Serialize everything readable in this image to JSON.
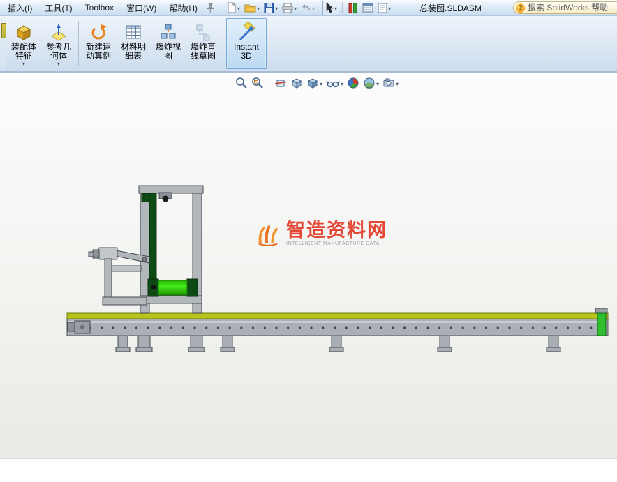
{
  "window": {
    "document_title": "总装图.SLDASM"
  },
  "menubar": {
    "items": [
      "插入(I)",
      "工具(T)",
      "Toolbox",
      "窗口(W)",
      "帮助(H)"
    ],
    "search_placeholder": "搜索 SolidWorks 帮助"
  },
  "quick_toolbar": {
    "icons": [
      "new-document",
      "open-folder",
      "save",
      "print",
      "undo",
      "select-cursor",
      "rebuild",
      "properties",
      "options"
    ]
  },
  "command_manager": {
    "buttons": [
      {
        "label": "装配体特征"
      },
      {
        "label": "参考几何体"
      },
      {
        "label": "新建运动算例"
      },
      {
        "label": "材料明细表"
      },
      {
        "label": "爆炸视图"
      },
      {
        "label": "爆炸直线草图"
      },
      {
        "label": "Instant3D"
      }
    ]
  },
  "hud_toolbar": {
    "icons": [
      "zoom-fit",
      "zoom-area",
      "section-view",
      "view-orientation",
      "display-style",
      "hide-show-items",
      "edit-appearance",
      "apply-scene",
      "view-settings"
    ]
  },
  "watermark": {
    "title": "智造资料网",
    "subtitle": "INTELLIGENT MANUFACTURE DATA"
  },
  "colors": {
    "menubar_top": "#f8fbfe",
    "menubar_bottom": "#c9ddf0",
    "command_bar_bg": "#dae6f3",
    "active_button_border": "#74a9dc",
    "conveyor_stripe": "#b8c41e",
    "machine_gray": "#b2b7bc",
    "roller_green": "#46ec1a",
    "belt_dark_green": "#0e4a14",
    "watermark_red": "#e23a28",
    "watermark_orange": "#ef8c1f"
  }
}
